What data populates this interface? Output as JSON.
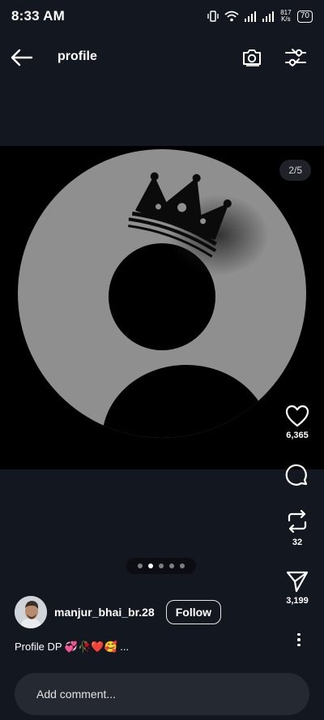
{
  "status_bar": {
    "time": "8:33 AM",
    "speed_value": "817",
    "speed_unit": "K/s",
    "battery": "70"
  },
  "header": {
    "title": "profile",
    "back_icon": "arrow-left-icon",
    "camera_icon": "camera-icon",
    "filter_icon": "sliders-icon"
  },
  "media": {
    "page_counter": "2/5",
    "total_pages": 5,
    "active_page": 2
  },
  "actions": {
    "likes": "6,365",
    "comments": "",
    "reposts": "32",
    "shares": "3,199"
  },
  "post": {
    "username": "manjur_bhai_br.28",
    "follow_label": "Follow",
    "caption": "Profile DP 💞🥀❤️🥰 ..."
  },
  "comment": {
    "placeholder": "Add comment..."
  },
  "colors": {
    "background": "#131720",
    "media_background": "#000000",
    "art_gray": "#8f8f8f"
  }
}
